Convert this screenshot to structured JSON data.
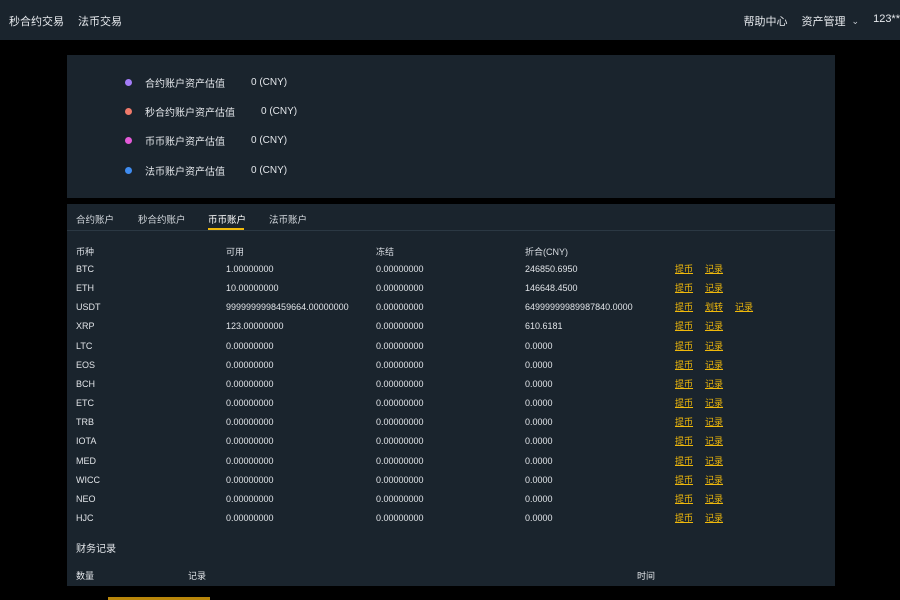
{
  "topbar": {
    "left_items": [
      "秒合约交易",
      "法币交易"
    ],
    "help": "帮助中心",
    "asset_mgmt": "资产管理",
    "user": "123**"
  },
  "summary": {
    "rows": [
      {
        "label": "合约账户资产估值",
        "value": "0  (CNY)",
        "color": "#a37cf7"
      },
      {
        "label": "秒合约账户资产估值",
        "value": "0  (CNY)",
        "color": "#f07a6a"
      },
      {
        "label": "币币账户资产估值",
        "value": "0  (CNY)",
        "color": "#e45ad8"
      },
      {
        "label": "法币账户资产估值",
        "value": "0  (CNY)",
        "color": "#3f8cf0"
      }
    ]
  },
  "tabs": [
    "合约账户",
    "秒合约账户",
    "币币账户",
    "法币账户"
  ],
  "active_tab": "币币账户",
  "table": {
    "headers": [
      "币种",
      "可用",
      "冻结",
      "折合(CNY)"
    ],
    "rows": [
      {
        "coin": "BTC",
        "available": "1.00000000",
        "frozen": "0.00000000",
        "cny": "246850.6950",
        "actions": [
          "提币",
          "记录"
        ]
      },
      {
        "coin": "ETH",
        "available": "10.00000000",
        "frozen": "0.00000000",
        "cny": "146648.4500",
        "actions": [
          "提币",
          "记录"
        ]
      },
      {
        "coin": "USDT",
        "available": "9999999998459664.00000000",
        "frozen": "0.00000000",
        "cny": "64999999989987840.0000",
        "actions": [
          "提币",
          "划转",
          "记录"
        ]
      },
      {
        "coin": "XRP",
        "available": "123.00000000",
        "frozen": "0.00000000",
        "cny": "610.6181",
        "actions": [
          "提币",
          "记录"
        ]
      },
      {
        "coin": "LTC",
        "available": "0.00000000",
        "frozen": "0.00000000",
        "cny": "0.0000",
        "actions": [
          "提币",
          "记录"
        ]
      },
      {
        "coin": "EOS",
        "available": "0.00000000",
        "frozen": "0.00000000",
        "cny": "0.0000",
        "actions": [
          "提币",
          "记录"
        ]
      },
      {
        "coin": "BCH",
        "available": "0.00000000",
        "frozen": "0.00000000",
        "cny": "0.0000",
        "actions": [
          "提币",
          "记录"
        ]
      },
      {
        "coin": "ETC",
        "available": "0.00000000",
        "frozen": "0.00000000",
        "cny": "0.0000",
        "actions": [
          "提币",
          "记录"
        ]
      },
      {
        "coin": "TRB",
        "available": "0.00000000",
        "frozen": "0.00000000",
        "cny": "0.0000",
        "actions": [
          "提币",
          "记录"
        ]
      },
      {
        "coin": "IOTA",
        "available": "0.00000000",
        "frozen": "0.00000000",
        "cny": "0.0000",
        "actions": [
          "提币",
          "记录"
        ]
      },
      {
        "coin": "MED",
        "available": "0.00000000",
        "frozen": "0.00000000",
        "cny": "0.0000",
        "actions": [
          "提币",
          "记录"
        ]
      },
      {
        "coin": "WICC",
        "available": "0.00000000",
        "frozen": "0.00000000",
        "cny": "0.0000",
        "actions": [
          "提币",
          "记录"
        ]
      },
      {
        "coin": "NEO",
        "available": "0.00000000",
        "frozen": "0.00000000",
        "cny": "0.0000",
        "actions": [
          "提币",
          "记录"
        ]
      },
      {
        "coin": "HJC",
        "available": "0.00000000",
        "frozen": "0.00000000",
        "cny": "0.0000",
        "actions": [
          "提币",
          "记录"
        ]
      }
    ]
  },
  "finance": {
    "title": "财务记录",
    "headers": [
      "数量",
      "记录",
      "时间"
    ]
  },
  "colors": {
    "background": "#000000",
    "panel": "#1a242d",
    "accent": "#f0b90b"
  }
}
